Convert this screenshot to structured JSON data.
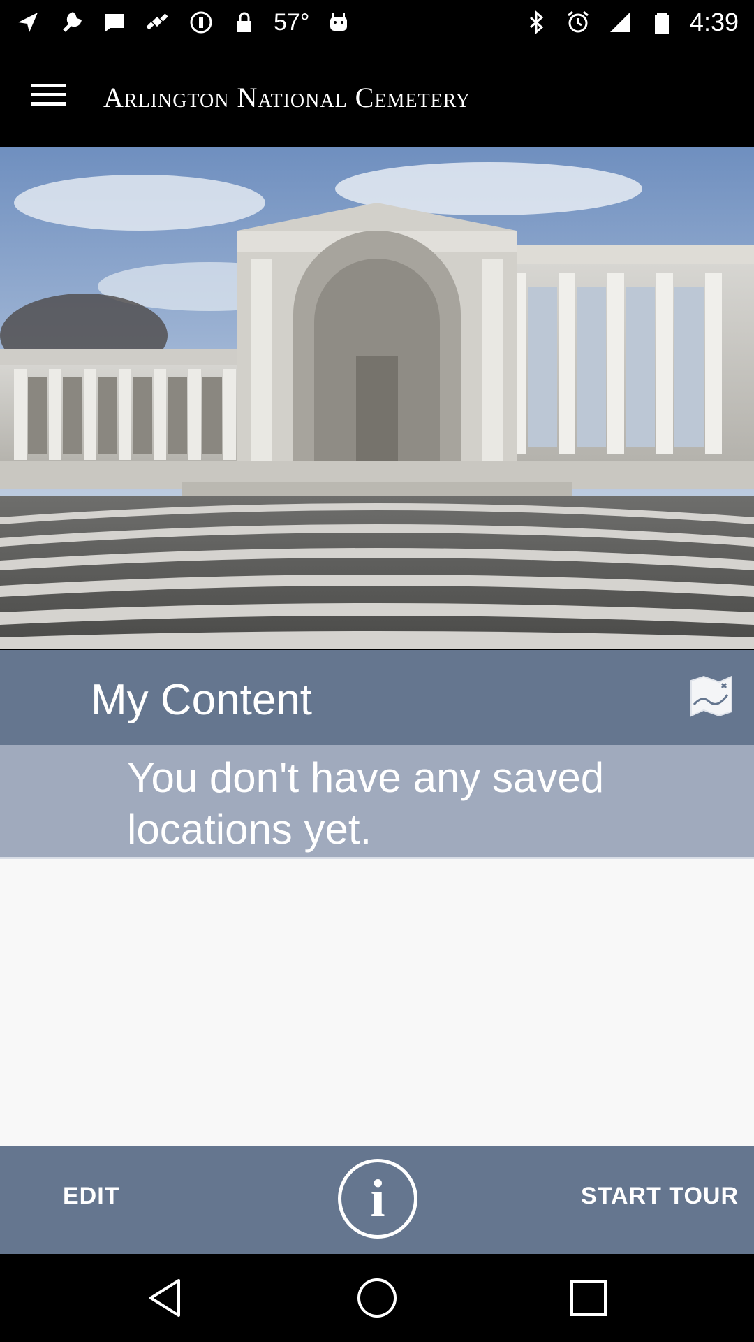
{
  "status_bar": {
    "temperature": "57°",
    "time": "4:39",
    "icons": [
      "navigation-icon",
      "wrench-icon",
      "chat-icon",
      "satellite-icon",
      "blocked-icon",
      "lock-icon",
      "android-icon",
      "bluetooth-icon",
      "alarm-icon",
      "signal-icon",
      "battery-icon"
    ]
  },
  "app_bar": {
    "title": "Arlington National Cemetery",
    "menu_icon": "hamburger-menu-icon"
  },
  "hero": {
    "image": "amphitheater-photo"
  },
  "content": {
    "title": "My Content",
    "map_icon": "map-icon",
    "empty_message": "You don't have any saved locations yet."
  },
  "toolbar": {
    "edit_label": "EDIT",
    "info_icon": "info-icon",
    "start_tour_label": "START TOUR"
  },
  "nav_bar": {
    "icons": [
      "back-icon",
      "home-icon",
      "recents-icon"
    ]
  },
  "colors": {
    "header_bg": "#65768f",
    "message_bg": "#a0aabd",
    "list_bg": "#f8f8f8"
  }
}
